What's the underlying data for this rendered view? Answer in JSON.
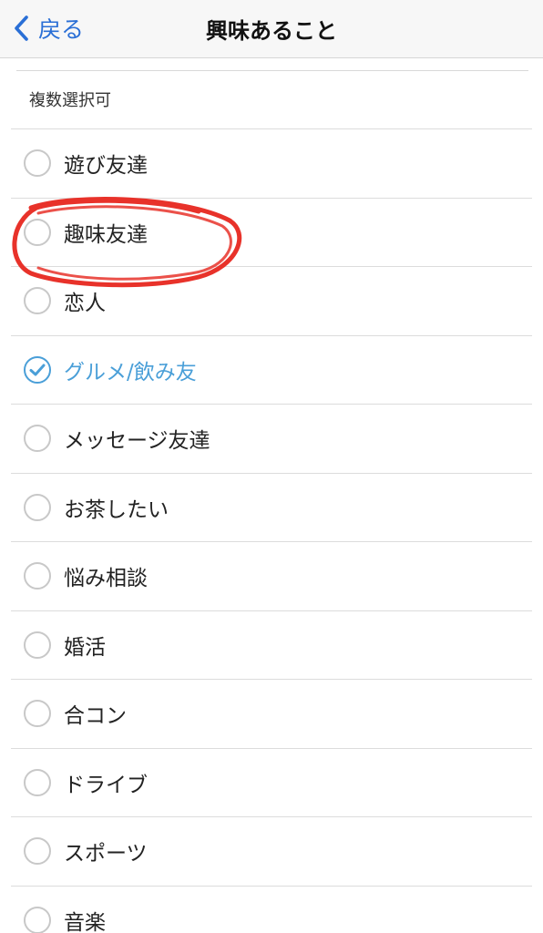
{
  "header": {
    "back_label": "戻る",
    "title": "興味あること"
  },
  "hint": "複数選択可",
  "options": [
    {
      "label": "遊び友達",
      "checked": false
    },
    {
      "label": "趣味友達",
      "checked": false
    },
    {
      "label": "恋人",
      "checked": false
    },
    {
      "label": "グルメ/飲み友",
      "checked": true
    },
    {
      "label": "メッセージ友達",
      "checked": false
    },
    {
      "label": "お茶したい",
      "checked": false
    },
    {
      "label": "悩み相談",
      "checked": false
    },
    {
      "label": "婚活",
      "checked": false
    },
    {
      "label": "合コン",
      "checked": false
    },
    {
      "label": "ドライブ",
      "checked": false
    },
    {
      "label": "スポーツ",
      "checked": false
    },
    {
      "label": "音楽",
      "checked": false
    }
  ],
  "colors": {
    "accent": "#4a9fd8",
    "back_link": "#2a6fd6",
    "annotation": "#e8322a"
  }
}
